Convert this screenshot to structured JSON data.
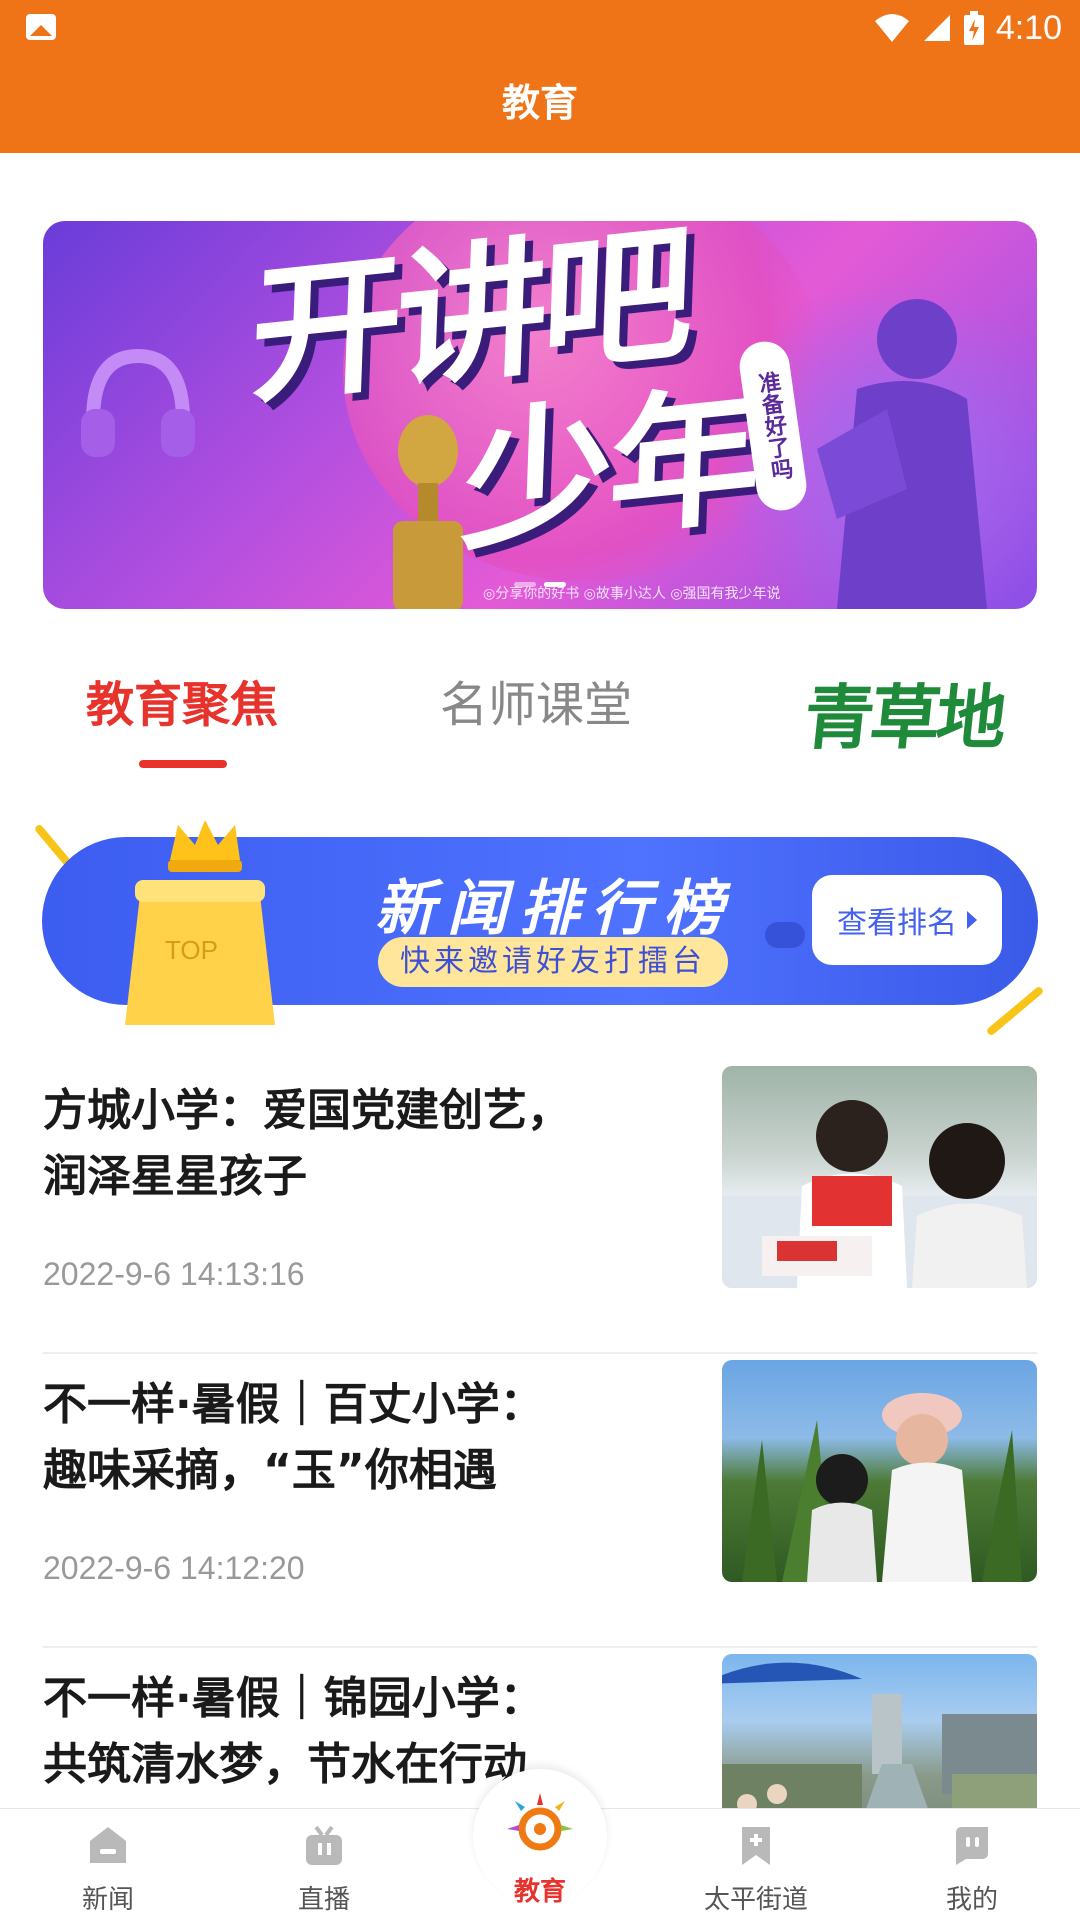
{
  "status_bar": {
    "time": "4:10"
  },
  "header": {
    "title": "教育"
  },
  "banner": {
    "title_line1": "开讲吧",
    "title_line2": "少年",
    "tag": "准备好了吗",
    "caption": "◎分享你的好书 ◎故事小达人 ◎强国有我少年说",
    "dots": 2,
    "active_dot": 1
  },
  "tabs": {
    "focus": "教育聚焦",
    "teacher": "名师课堂",
    "grass": "青草地"
  },
  "rank_banner": {
    "title": "新闻排行榜",
    "subtitle": "快来邀请好友打擂台",
    "button": "查看排名",
    "trophy_label": "TOP"
  },
  "news": [
    {
      "title": "方城小学：爱国党建创艺，\n润泽星星孩子",
      "time": "2022-9-6 14:13:16"
    },
    {
      "title": "不一样·暑假｜百丈小学：\n趣味采摘，“玉”你相遇",
      "time": "2022-9-6 14:12:20"
    },
    {
      "title": "不一样·暑假｜锦园小学：\n共筑清水梦，节水在行动",
      "time": ""
    }
  ],
  "bottom_nav": [
    {
      "label": "新闻",
      "icon": "news-icon"
    },
    {
      "label": "直播",
      "icon": "tv-icon"
    },
    {
      "label": "教育",
      "icon": "education-logo-icon"
    },
    {
      "label": "太平街道",
      "icon": "bookmark-plus-icon"
    },
    {
      "label": "我的",
      "icon": "user-chat-icon"
    }
  ],
  "colors": {
    "header": "#ef7418",
    "accent": "#e8322c",
    "rank_blue": "#4361ee"
  }
}
